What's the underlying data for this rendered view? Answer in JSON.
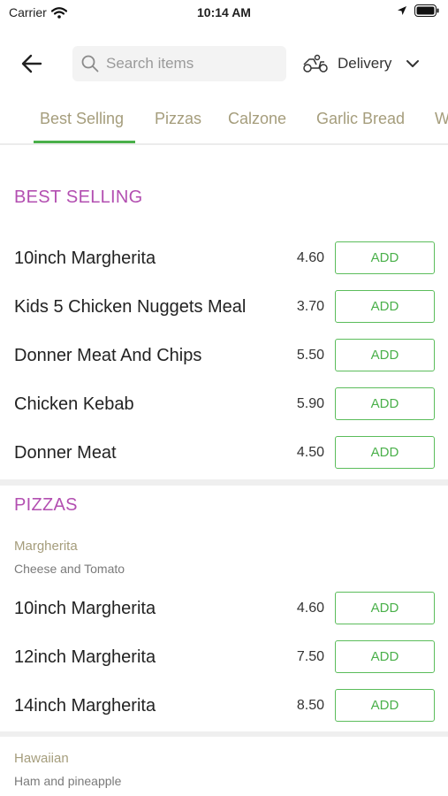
{
  "status_bar": {
    "carrier": "Carrier",
    "time": "10:14 AM"
  },
  "header": {
    "search_placeholder": "Search items",
    "delivery_label": "Delivery"
  },
  "tabs": [
    {
      "label": "Best Selling",
      "active": true
    },
    {
      "label": "Pizzas"
    },
    {
      "label": "Calzone"
    },
    {
      "label": "Garlic Bread"
    },
    {
      "label": "W"
    }
  ],
  "colors": {
    "accent_green": "#4ab04a",
    "section_purple": "#b34fb1",
    "tab_tan": "#a59d7c"
  },
  "sections": {
    "best_selling": {
      "title": "BEST SELLING",
      "items": [
        {
          "name": "10inch Margherita",
          "price": "4.60",
          "button": "ADD"
        },
        {
          "name": "Kids 5 Chicken Nuggets Meal",
          "price": "3.70",
          "button": "ADD"
        },
        {
          "name": "Donner Meat And Chips",
          "price": "5.50",
          "button": "ADD"
        },
        {
          "name": "Chicken Kebab",
          "price": "5.90",
          "button": "ADD"
        },
        {
          "name": "Donner Meat",
          "price": "4.50",
          "button": "ADD"
        }
      ]
    },
    "pizzas": {
      "title": "PIZZAS",
      "groups": [
        {
          "title": "Margherita",
          "description": "Cheese and Tomato",
          "items": [
            {
              "name": "10inch Margherita",
              "price": "4.60",
              "button": "ADD"
            },
            {
              "name": "12inch Margherita",
              "price": "7.50",
              "button": "ADD"
            },
            {
              "name": "14inch Margherita",
              "price": "8.50",
              "button": "ADD"
            }
          ]
        },
        {
          "title": "Hawaiian",
          "description": "Ham and pineapple"
        }
      ]
    }
  }
}
